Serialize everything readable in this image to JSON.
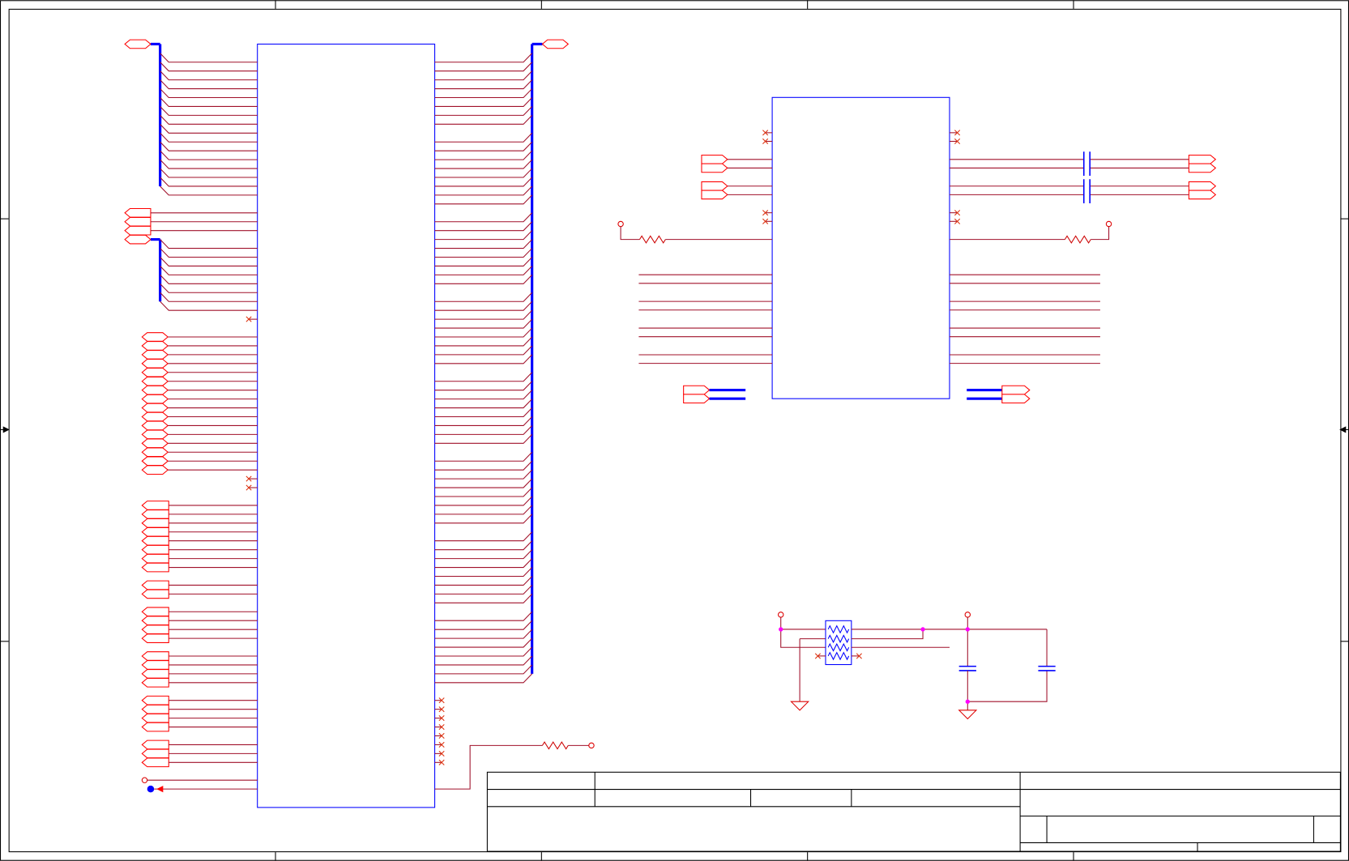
{
  "sheet": {
    "colors": {
      "background": "#ffffff",
      "frame": "#000000",
      "wire": "#a0102a",
      "port": "#ff0000",
      "bus": "#0000ff",
      "component": "#0000ff",
      "resistor": "#cc0000",
      "junction": "#ff00ff",
      "no_connect": "#dd3311",
      "power": "#dd0000",
      "ground": "#dd0000"
    },
    "icons": {
      "net_port": "net-port-icon",
      "power_port": "power-port-icon",
      "ground": "ground-icon",
      "resistor": "resistor-icon",
      "resistor_array": "resistor-array-icon",
      "capacitor": "capacitor-icon",
      "no_connect": "no-connect-icon",
      "junction": "junction-dot-icon",
      "test_point": "test-point-icon",
      "zone_arrow": "zone-arrow-icon"
    }
  }
}
